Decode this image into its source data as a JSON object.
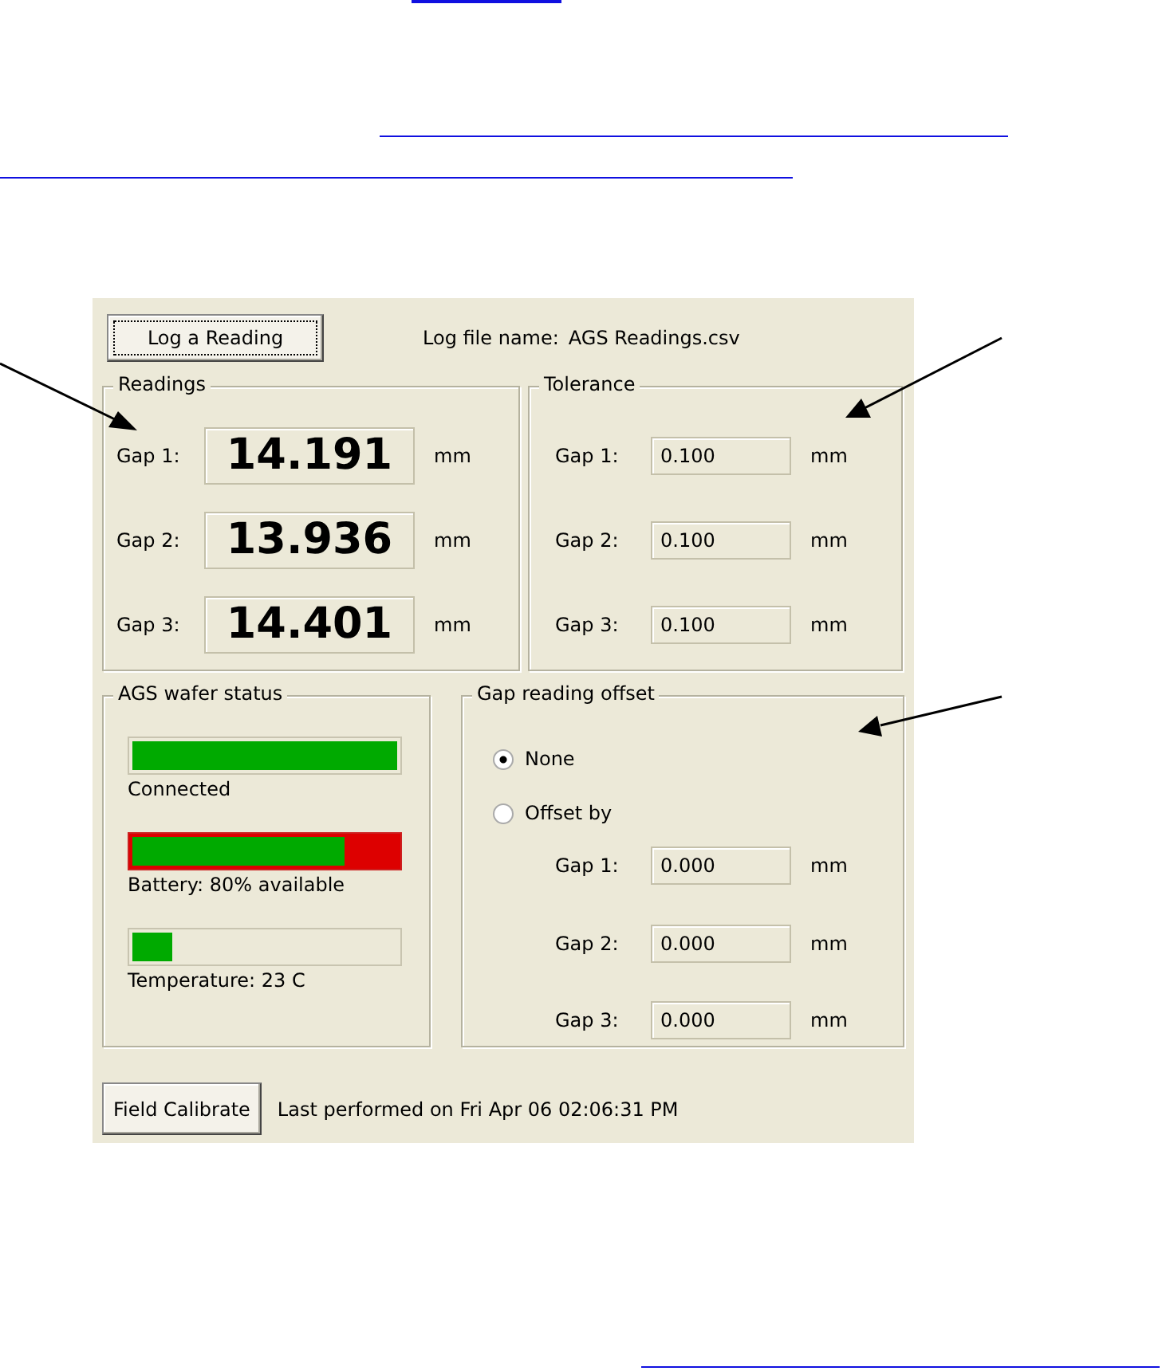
{
  "log_button": "Log a Reading",
  "log_file": {
    "label": "Log file name:",
    "value": "AGS Readings.csv"
  },
  "readings": {
    "title": "Readings",
    "rows": [
      {
        "label": "Gap 1:",
        "value": "14.191",
        "unit": "mm"
      },
      {
        "label": "Gap 2:",
        "value": "13.936",
        "unit": "mm"
      },
      {
        "label": "Gap 3:",
        "value": "14.401",
        "unit": "mm"
      }
    ]
  },
  "tolerance": {
    "title": "Tolerance",
    "rows": [
      {
        "label": "Gap 1:",
        "value": "0.100",
        "unit": "mm"
      },
      {
        "label": "Gap 2:",
        "value": "0.100",
        "unit": "mm"
      },
      {
        "label": "Gap 3:",
        "value": "0.100",
        "unit": "mm"
      }
    ]
  },
  "wafer_status": {
    "title": "AGS wafer status",
    "meters": [
      {
        "kind": "plain",
        "level": 1.0,
        "label": "Connected"
      },
      {
        "kind": "battery",
        "level": 0.8,
        "label": "Battery: 80% available"
      },
      {
        "kind": "plain",
        "level": 0.15,
        "label": "Temperature: 23 C"
      }
    ]
  },
  "offset": {
    "title": "Gap reading offset",
    "options": [
      {
        "label": "None",
        "selected": true
      },
      {
        "label": "Offset by",
        "selected": false
      }
    ],
    "rows": [
      {
        "label": "Gap 1:",
        "value": "0.000",
        "unit": "mm"
      },
      {
        "label": "Gap 2:",
        "value": "0.000",
        "unit": "mm"
      },
      {
        "label": "Gap 3:",
        "value": "0.000",
        "unit": "mm"
      }
    ]
  },
  "calibrate": {
    "button": "Field Calibrate",
    "last_performed": "Last performed on Fri Apr 06 02:06:31 PM"
  }
}
